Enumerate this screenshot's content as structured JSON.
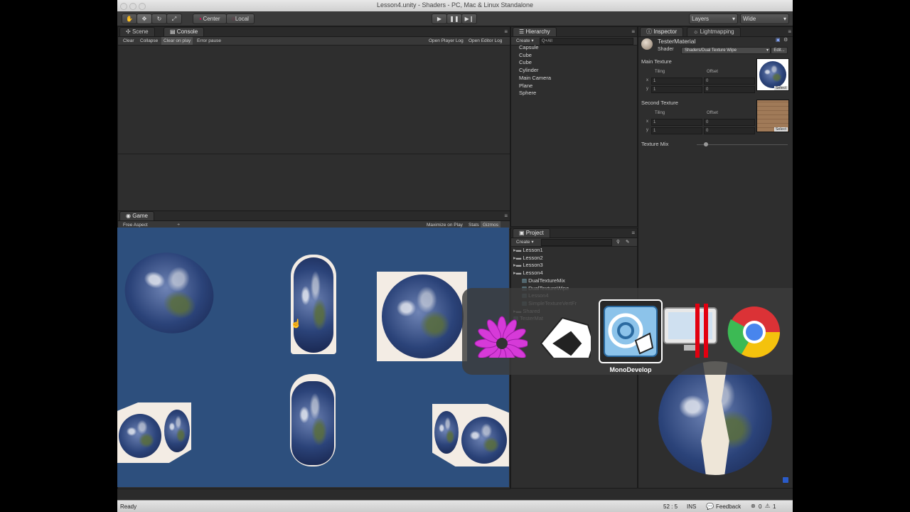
{
  "window": {
    "title": "Lesson4.unity - Shaders - PC, Mac & Linux Standalone"
  },
  "toolbar": {
    "pivot_label": "Center",
    "space_label": "Local",
    "layers_label": "Layers",
    "layout_label": "Wide"
  },
  "console": {
    "tabs": [
      {
        "label": "Scene"
      },
      {
        "label": "Console"
      }
    ],
    "buttons": [
      "Clear",
      "Collapse",
      "Clear on play",
      "Error pause"
    ],
    "right_buttons": [
      "Open Player Log",
      "Open Editor Log"
    ]
  },
  "game": {
    "tab": "Game",
    "aspect": "Free Aspect",
    "buttons": [
      "Maximize on Play",
      "Stats",
      "Gizmos"
    ]
  },
  "hierarchy": {
    "tab": "Hierarchy",
    "create": "Create",
    "search_placeholder": "Q+All",
    "items": [
      "Capsule",
      "Cube",
      "Cube",
      "Cylinder",
      "Main Camera",
      "Plane",
      "Sphere"
    ]
  },
  "project": {
    "tab": "Project",
    "create": "Create",
    "items": [
      "Lesson1",
      "Lesson2",
      "Lesson3",
      "Lesson4",
      "DualTextureMix",
      "DualTextureWipe",
      "Lesson4",
      "SimpleTextureVertFr",
      "Shared",
      "TesterMat"
    ]
  },
  "inspector": {
    "tabs": [
      {
        "label": "Inspector"
      },
      {
        "label": "Lightmapping"
      }
    ],
    "material_name": "TesterMaterial",
    "shader_label": "Shader",
    "shader_value": "Shaders/Dual Texture Wipe",
    "edit_label": "Edit...",
    "main_texture": {
      "label": "Main Texture",
      "tiling": "Tiling",
      "offset": "Offset",
      "x": "x",
      "y": "y",
      "tx": "1",
      "ty": "1",
      "ox": "0",
      "oy": "0",
      "select": "Select"
    },
    "second_texture": {
      "label": "Second Texture",
      "tiling": "Tiling",
      "offset": "Offset",
      "x": "x",
      "y": "y",
      "tx": "1",
      "ty": "1",
      "ox": "0",
      "oy": "0",
      "select": "Select"
    },
    "texture_mix": {
      "label": "Texture Mix",
      "value": 0.1
    }
  },
  "switcher": {
    "selected_app": "MonoDevelop"
  },
  "status": {
    "left": "Ready",
    "cursor": "52 : 5",
    "mode": "INS",
    "feedback": "Feedback",
    "errors": "0",
    "warnings": "1"
  }
}
